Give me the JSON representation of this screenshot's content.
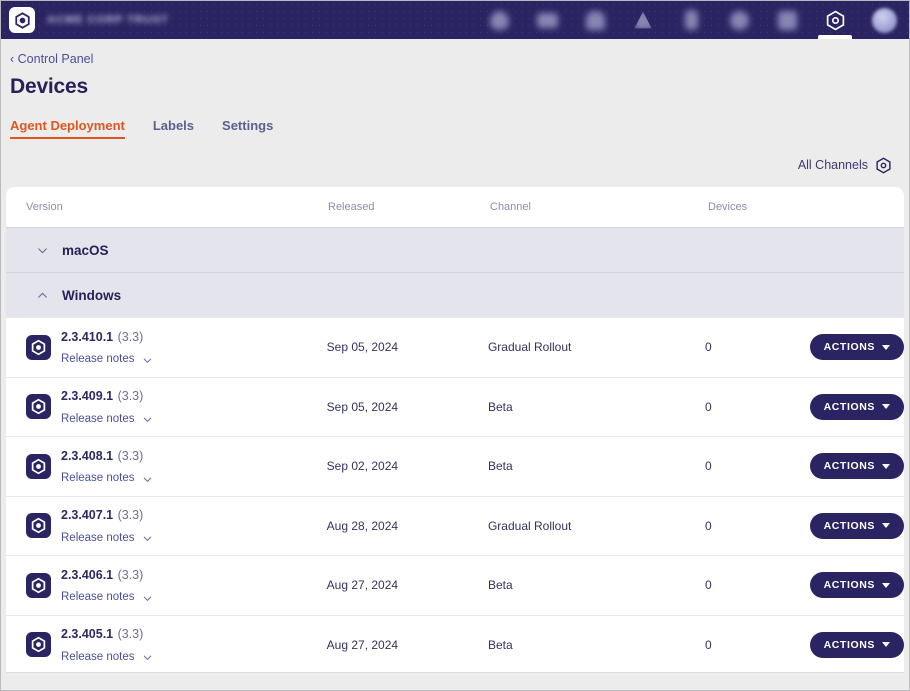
{
  "topnav": {
    "logo_icon": "hexagon-logo-icon",
    "brand_text": "ACME CORP TRUST",
    "icons": [
      {
        "name": "nav-icon-dashboard",
        "shape": "b-drop"
      },
      {
        "name": "nav-icon-cloud",
        "shape": "b-wide"
      },
      {
        "name": "nav-icon-alerts",
        "shape": "b-bell"
      },
      {
        "name": "nav-icon-reports",
        "shape": "b-tri"
      },
      {
        "name": "nav-icon-devices",
        "shape": "b-tall"
      },
      {
        "name": "nav-icon-shield",
        "shape": "b-round"
      },
      {
        "name": "nav-icon-apps",
        "shape": "b-sq"
      }
    ],
    "settings_icon": "hexagon-gear-icon",
    "settings_active": true,
    "avatar": "user-avatar"
  },
  "breadcrumb": {
    "back_glyph": "‹",
    "label": "Control Panel"
  },
  "page_title": "Devices",
  "tabs": [
    {
      "label": "Agent Deployment",
      "active": true
    },
    {
      "label": "Labels",
      "active": false
    },
    {
      "label": "Settings",
      "active": false
    }
  ],
  "filter": {
    "label": "All Channels",
    "icon": "hexagon-gear-filter-icon"
  },
  "table": {
    "columns": {
      "version": "Version",
      "released": "Released",
      "channel": "Channel",
      "devices": "Devices"
    },
    "groups": [
      {
        "name": "macOS",
        "expanded": false,
        "chevron": "chevron-down-icon",
        "rows": []
      },
      {
        "name": "Windows",
        "expanded": true,
        "chevron": "chevron-up-icon",
        "rows": [
          {
            "version": "2.3.410.1",
            "build": "(3.3)",
            "release_notes": "Release notes",
            "released": "Sep 05, 2024",
            "channel": "Gradual Rollout",
            "devices": "0",
            "action": "ACTIONS"
          },
          {
            "version": "2.3.409.1",
            "build": "(3.3)",
            "release_notes": "Release notes",
            "released": "Sep 05, 2024",
            "channel": "Beta",
            "devices": "0",
            "action": "ACTIONS"
          },
          {
            "version": "2.3.408.1",
            "build": "(3.3)",
            "release_notes": "Release notes",
            "released": "Sep 02, 2024",
            "channel": "Beta",
            "devices": "0",
            "action": "ACTIONS"
          },
          {
            "version": "2.3.407.1",
            "build": "(3.3)",
            "release_notes": "Release notes",
            "released": "Aug 28, 2024",
            "channel": "Gradual Rollout",
            "devices": "0",
            "action": "ACTIONS"
          },
          {
            "version": "2.3.406.1",
            "build": "(3.3)",
            "release_notes": "Release notes",
            "released": "Aug 27, 2024",
            "channel": "Beta",
            "devices": "0",
            "action": "ACTIONS"
          },
          {
            "version": "2.3.405.1",
            "build": "(3.3)",
            "release_notes": "Release notes",
            "released": "Aug 27, 2024",
            "channel": "Beta",
            "devices": "0",
            "action": "ACTIONS"
          }
        ]
      }
    ]
  },
  "colors": {
    "nav_background": "#2b2463",
    "accent_orange": "#e1561f",
    "title_navy": "#272157",
    "group_row": "#e4e4ec",
    "page_background": "#ececed"
  }
}
